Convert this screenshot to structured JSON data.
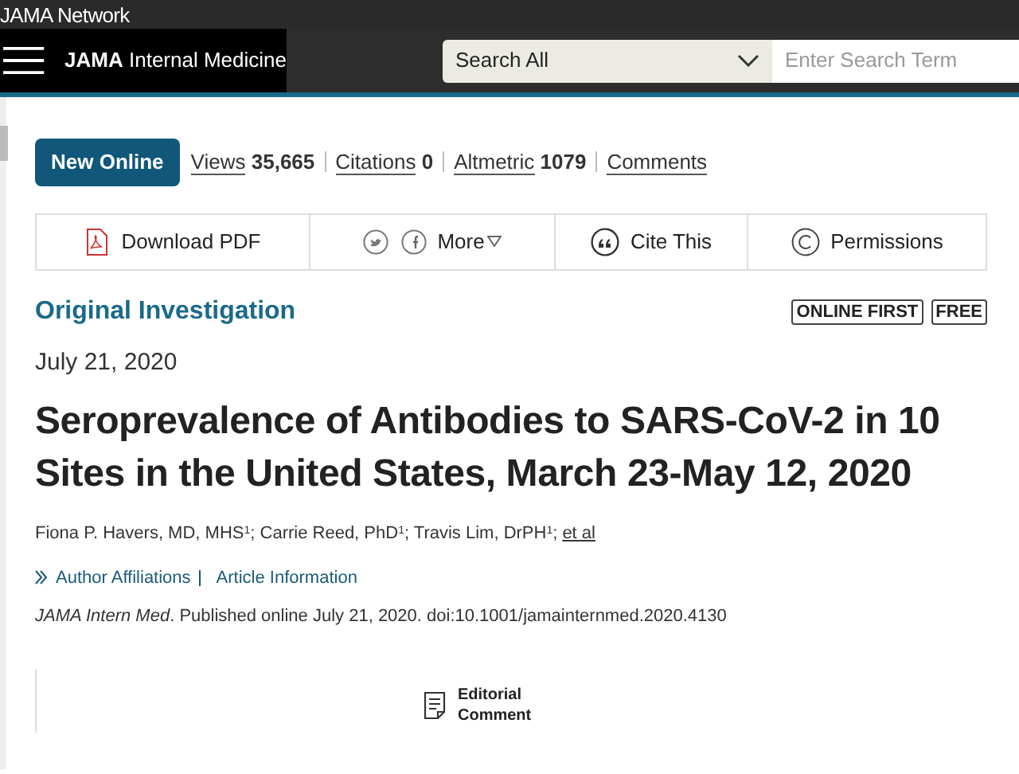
{
  "network_bar": {
    "brand": "JAMA Network"
  },
  "header": {
    "journal": "**JAMA** Internal Medicine",
    "search_scope": "Search All",
    "search_placeholder": "Enter Search Term"
  },
  "badge": "New Online",
  "metrics": [
    {
      "label": "Views",
      "value": "35,665"
    },
    {
      "label": "Citations",
      "value": "0"
    },
    {
      "label": "Altmetric",
      "value": "1079"
    },
    {
      "label": "Comments"
    }
  ],
  "actions": [
    {
      "kind": "pdf",
      "label": "Download PDF"
    },
    {
      "kind": "social",
      "label": "More"
    },
    {
      "kind": "cite",
      "label": "Cite This"
    },
    {
      "kind": "permissions",
      "label": "Permissions"
    }
  ],
  "article_type": "Original Investigation",
  "tags": [
    "ONLINE FIRST",
    "FREE"
  ],
  "date": "July 21, 2020",
  "title": "Seroprevalence of Antibodies to SARS-CoV-2 in 10 Sites in the United States, March 23-May 12, 2020",
  "authors": "Fiona P. Havers, MD, MHS$^{1}$; Carrie Reed, PhD$^{1}$; Travis Lim, DrPH$^{1}$;",
  "et_al": "et al",
  "info_links": [
    "Author Affiliations",
    "Article Information"
  ],
  "citation": "*JAMA Intern Med*. Published online July 21, 2020. doi:10.1001/jamainternmed.2020.4130",
  "related": "Editorial Comment"
}
